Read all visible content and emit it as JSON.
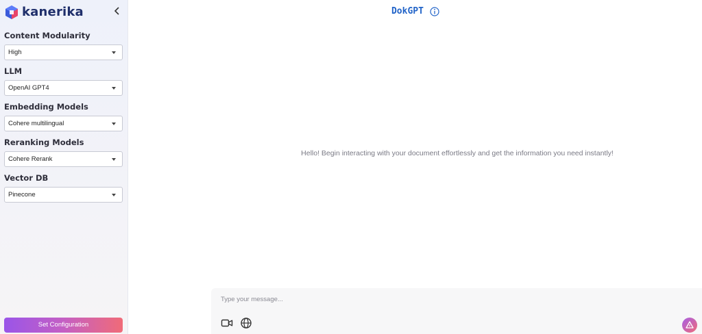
{
  "brand": {
    "name": "kanerika"
  },
  "sidebar": {
    "collapse_icon": "chevron-left-icon",
    "fields": [
      {
        "label": "Content Modularity",
        "value": "High"
      },
      {
        "label": "LLM",
        "value": "OpenAI GPT4"
      },
      {
        "label": "Embedding Models",
        "value": "Cohere multilingual"
      },
      {
        "label": "Reranking Models",
        "value": "Cohere Rerank"
      },
      {
        "label": "Vector DB",
        "value": "Pinecone"
      }
    ],
    "set_button_label": "Set Configuration"
  },
  "header": {
    "title": "DokGPT",
    "info_icon": "info-circle-icon"
  },
  "main": {
    "welcome_text": "Hello! Begin interacting with your document effortlessly and get the information you need instantly!"
  },
  "composer": {
    "placeholder": "Type your message...",
    "video_icon": "video-camera-icon",
    "globe_icon": "globe-icon",
    "send_icon": "send-icon"
  },
  "colors": {
    "accent_title": "#2264c8",
    "button_gradient_start": "#9a55e8",
    "button_gradient_end": "#f06b78"
  }
}
